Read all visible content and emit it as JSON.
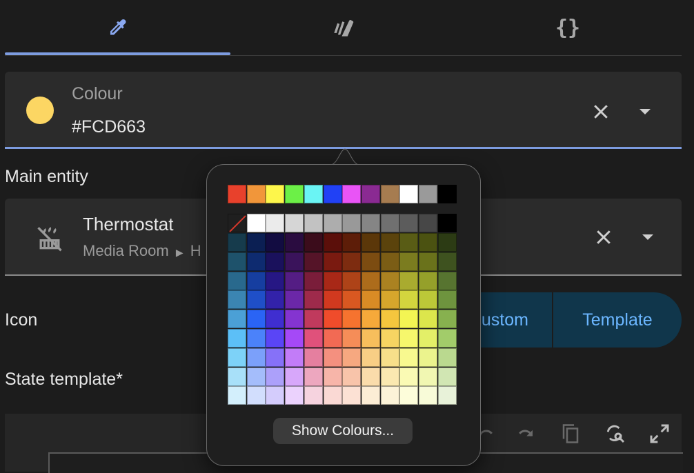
{
  "tabs": [
    {
      "name": "tab-color-picker",
      "icon": "eyedropper-icon"
    },
    {
      "name": "tab-style",
      "icon": "palette-swatch-icon"
    },
    {
      "name": "tab-code",
      "icon": "code-braces-icon",
      "glyph": "{}"
    }
  ],
  "colour_field": {
    "label": "Colour",
    "value": "#FCD663",
    "swatch_color": "#FCD663",
    "accent": "#7d9ce0"
  },
  "main_entity": {
    "section_label": "Main entity",
    "name": "Thermostat",
    "area": "Media Room",
    "area_suffix": "H",
    "icon": "thermostat-off-icon"
  },
  "icon_section": {
    "label": "Icon",
    "options": [
      "Custom",
      "Template"
    ],
    "custom_visible_text": "ustom",
    "accent": "#6bb6ff"
  },
  "state_template": {
    "label": "State template*"
  },
  "editor_toolbar": {
    "icons": [
      "undo-icon",
      "redo-icon",
      "copy-icon",
      "search-replace-icon",
      "fullscreen-icon"
    ]
  },
  "color_popover": {
    "basic_colors": [
      "#e8412c",
      "#f1963a",
      "#fdf64b",
      "#6cf047",
      "#6af4f4",
      "#2141f5",
      "#e954f6",
      "#8a2a92",
      "#a67c50",
      "#ffffff",
      "#9a9a9a",
      "#000000"
    ],
    "grays": [
      "none",
      "#ffffff",
      "#ebebeb",
      "#d6d6d6",
      "#c2c2c2",
      "#adadad",
      "#999999",
      "#858585",
      "#707070",
      "#5c5c5c",
      "#474747",
      "#000000"
    ],
    "grid": [
      [
        "#163b4c",
        "#0b1f53",
        "#120c41",
        "#2a0c40",
        "#3b0c1b",
        "#5b0f0a",
        "#5d1d08",
        "#5b3709",
        "#5b430c",
        "#595c15",
        "#4b5211",
        "#2c3b14"
      ],
      [
        "#1e526b",
        "#0e2b70",
        "#1a115c",
        "#3a135b",
        "#551428",
        "#7a1a10",
        "#7d2c10",
        "#7c4c11",
        "#7b5d15",
        "#7b7c1f",
        "#6a721b",
        "#3e521f"
      ],
      [
        "#29698d",
        "#163ea0",
        "#261784",
        "#541d84",
        "#7a1d3a",
        "#a82817",
        "#ae4318",
        "#ad6c1b",
        "#ab8221",
        "#a9ab2f",
        "#95a02a",
        "#577430"
      ],
      [
        "#3b85b2",
        "#1f4fc8",
        "#3222a9",
        "#6b27a8",
        "#9e2a4b",
        "#d1391f",
        "#d95821",
        "#d98b25",
        "#d6a62c",
        "#d3d53e",
        "#bcc838",
        "#6e943e"
      ],
      [
        "#4ba0d6",
        "#2a64f5",
        "#3f2ed0",
        "#8434d0",
        "#c03a5d",
        "#f04c2b",
        "#f6732f",
        "#f6a93a",
        "#f4c63e",
        "#f3f553",
        "#dce64c",
        "#87b14f"
      ],
      [
        "#5cbff7",
        "#4b82fa",
        "#5a45f6",
        "#a549f7",
        "#e0517b",
        "#f26a54",
        "#f58d58",
        "#f7be5c",
        "#f6d462",
        "#f6f76c",
        "#e3ef68",
        "#a2cc6a"
      ],
      [
        "#7dd2f8",
        "#7ba0fa",
        "#8671f8",
        "#c27cf8",
        "#e57f9f",
        "#f4907f",
        "#f6a880",
        "#f8ce85",
        "#f7df8a",
        "#f8f98f",
        "#ebf38d",
        "#bad98f"
      ],
      [
        "#a8e0f9",
        "#a4bdfb",
        "#aca0fa",
        "#d7a7fa",
        "#eda7bf",
        "#f7b5a9",
        "#f8c4aa",
        "#fadcab",
        "#fae8b0",
        "#fafab4",
        "#f1f7b2",
        "#d1e6b3"
      ],
      [
        "#d3effc",
        "#d2defd",
        "#d4ccfc",
        "#ebd2fd",
        "#f6d3df",
        "#fad9d4",
        "#fce1d4",
        "#fcedd5",
        "#fcf3d8",
        "#fdfdda",
        "#f8fbd8",
        "#e8f2d9"
      ]
    ],
    "button_label": "Show Colours..."
  }
}
